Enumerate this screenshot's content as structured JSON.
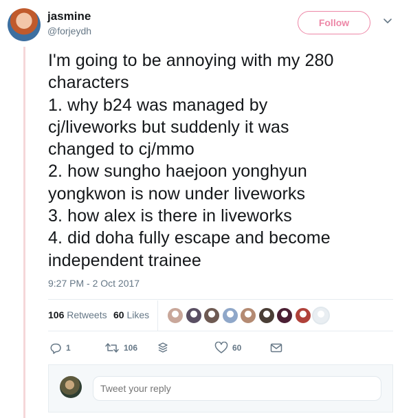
{
  "user": {
    "name": "jasmine",
    "handle": "@forjeydh",
    "follow_label": "Follow"
  },
  "tweet": {
    "text": "I'm going to be annoying with my 280\ncharacters\n1. why b24 was managed by\ncj/liveworks but suddenly it was\nchanged to cj/mmo\n2. how sungho haejoon yonghyun\nyongkwon is now under liveworks\n3. how alex is there in liveworks\n4. did doha fully escape and become\nindependent trainee",
    "timestamp": "9:27 PM - 2 Oct 2017"
  },
  "stats": {
    "retweets_count": "106",
    "retweets_label": "Retweets",
    "likes_count": "60",
    "likes_label": "Likes"
  },
  "likers": [
    {
      "name": "liker-avatar-1",
      "color": "#c9a79a"
    },
    {
      "name": "liker-avatar-2",
      "color": "#5a4f63"
    },
    {
      "name": "liker-avatar-3",
      "color": "#6e5a52"
    },
    {
      "name": "liker-avatar-4",
      "color": "#8fa7c9"
    },
    {
      "name": "liker-avatar-5",
      "color": "#b48a72"
    },
    {
      "name": "liker-avatar-6",
      "color": "#4a3e36"
    },
    {
      "name": "liker-avatar-7",
      "color": "#4b1f34"
    },
    {
      "name": "liker-avatar-8",
      "color": "#b0413a"
    },
    {
      "name": "liker-avatar-9",
      "color": "#e9eef2"
    }
  ],
  "actions": {
    "reply_count": "1",
    "retweet_count": "106",
    "like_count": "60"
  },
  "reply": {
    "placeholder": "Tweet your reply"
  },
  "colors": {
    "follow_accent": "#e0245e",
    "secondary_text": "#657786",
    "thread_rule": "#f5d7d9"
  },
  "icons": [
    "caret-down-icon",
    "reply-icon",
    "retweet-icon",
    "layers-icon",
    "heart-icon",
    "message-icon"
  ]
}
